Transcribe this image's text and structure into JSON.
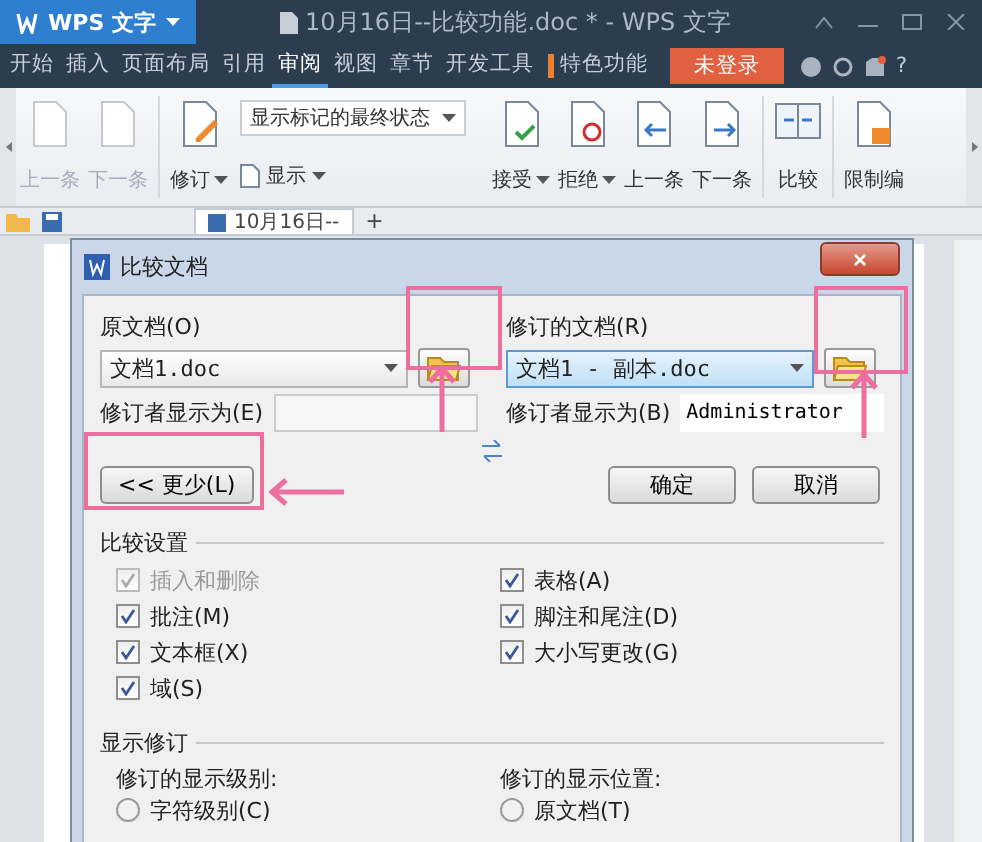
{
  "window": {
    "app_button": "WPS 文字",
    "title": "10月16日--比较功能.doc * - WPS 文字"
  },
  "menu": {
    "tabs": [
      {
        "label": "开始",
        "selected": false
      },
      {
        "label": "插入",
        "selected": false
      },
      {
        "label": "页面布局",
        "selected": false
      },
      {
        "label": "引用",
        "selected": false
      },
      {
        "label": "审阅",
        "selected": true
      },
      {
        "label": "视图",
        "selected": false
      },
      {
        "label": "章节",
        "selected": false
      },
      {
        "label": "开发工具",
        "selected": false
      },
      {
        "label": "特色功能",
        "selected": false
      }
    ],
    "login_button": "未登录",
    "help": "?"
  },
  "ribbon": {
    "nav": [
      {
        "label": "上一条",
        "disabled": true
      },
      {
        "label": "下一条",
        "disabled": true
      }
    ],
    "track_button": "修订",
    "markup_combo": "显示标记的最终状态",
    "show_button": "显示",
    "review": [
      {
        "label": "接受",
        "dropdown": true
      },
      {
        "label": "拒绝",
        "dropdown": true
      },
      {
        "label": "上一条",
        "dropdown": false
      },
      {
        "label": "下一条",
        "dropdown": false
      }
    ],
    "compare_button": "比较",
    "restrict_button": "限制编"
  },
  "doc_tab": {
    "label": "10月16日--",
    "new_tab": "+"
  },
  "dialog": {
    "title": "比较文档",
    "close": "×",
    "original": {
      "label": "原文档(O)",
      "value": "文档1.doc",
      "focused": false,
      "author_label": "修订者显示为(E)"
    },
    "revised": {
      "label": "修订的文档(R)",
      "value": "文档1 - 副本.doc",
      "focused": true,
      "author_label": "修订者显示为(B)",
      "author": "Administrator"
    },
    "less_button": "<< 更少(L)",
    "ok_button": "确定",
    "cancel_button": "取消",
    "compare_settings": {
      "title": "比较设置",
      "options": [
        {
          "label": "插入和删除",
          "checked": true,
          "disabled": true
        },
        {
          "label": "表格(A)",
          "checked": true,
          "disabled": false
        },
        {
          "label": "批注(M)",
          "checked": true,
          "disabled": false
        },
        {
          "label": "脚注和尾注(D)",
          "checked": true,
          "disabled": false
        },
        {
          "label": "文本框(X)",
          "checked": true,
          "disabled": false
        },
        {
          "label": "大小写更改(G)",
          "checked": true,
          "disabled": false
        },
        {
          "label": "域(S)",
          "checked": true,
          "disabled": false
        }
      ]
    },
    "show_changes": {
      "title": "显示修订",
      "groups": [
        {
          "label": "修订的显示级别:",
          "options": [
            {
              "label": "字符级别(C)",
              "selected": false
            }
          ]
        },
        {
          "label": "修订的显示位置:",
          "options": [
            {
              "label": "原文档(T)",
              "selected": false
            }
          ]
        }
      ]
    }
  }
}
